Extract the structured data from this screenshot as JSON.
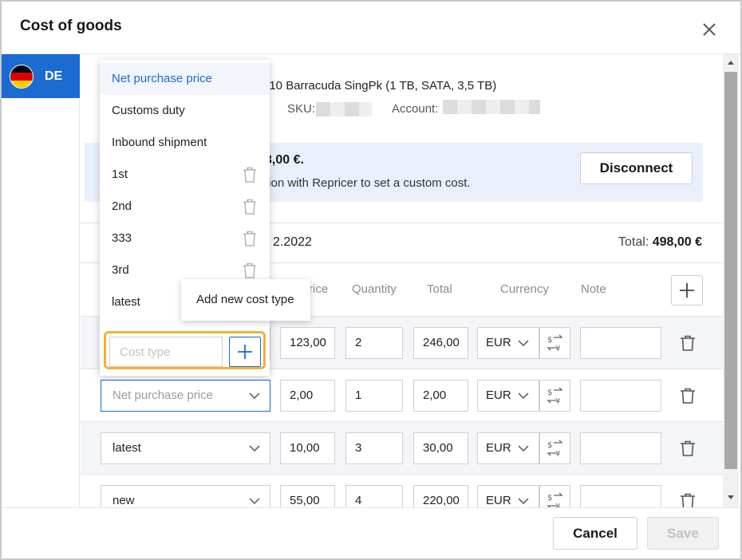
{
  "dialog": {
    "title": "Cost of goods",
    "close_icon": "close-icon"
  },
  "market": {
    "label": "DE",
    "flag_icon": "germany-flag-icon",
    "flag_colors": [
      "#000000",
      "#dd0000",
      "#ffce00"
    ]
  },
  "product": {
    "name": "010 Barracuda SingPk (1 TB, SATA, 3,5 TB)",
    "sku_label": "SKU:",
    "account_label": "Account:"
  },
  "info": {
    "price": "3,00 €.",
    "text": "tion with Repricer to set a custom cost.",
    "disconnect_label": "Disconnect"
  },
  "summary": {
    "date": "2.2022",
    "total_label": "Total:",
    "total_value": "498,00 €"
  },
  "columns": {
    "price": "rice",
    "quantity": "Quantity",
    "total": "Total",
    "currency": "Currency",
    "note": "Note"
  },
  "rows": [
    {
      "cost_type": "",
      "price": "123,00",
      "quantity": "2",
      "total": "246,00",
      "currency": "EUR",
      "note": ""
    },
    {
      "cost_type": "Net purchase price",
      "price": "2,00",
      "quantity": "1",
      "total": "2,00",
      "currency": "EUR",
      "note": ""
    },
    {
      "cost_type": "latest",
      "price": "10,00",
      "quantity": "3",
      "total": "30,00",
      "currency": "EUR",
      "note": ""
    },
    {
      "cost_type": "new",
      "price": "55,00",
      "quantity": "4",
      "total": "220,00",
      "currency": "EUR",
      "note": ""
    }
  ],
  "dropdown": {
    "items": [
      {
        "label": "Net purchase price",
        "deletable": false,
        "selected": true
      },
      {
        "label": "Customs duty",
        "deletable": false,
        "selected": false
      },
      {
        "label": "Inbound shipment",
        "deletable": false,
        "selected": false
      },
      {
        "label": "1st",
        "deletable": true,
        "selected": false
      },
      {
        "label": "2nd",
        "deletable": true,
        "selected": false
      },
      {
        "label": "333",
        "deletable": true,
        "selected": false
      },
      {
        "label": "3rd",
        "deletable": true,
        "selected": false
      },
      {
        "label": "latest",
        "deletable": false,
        "selected": false
      }
    ],
    "input_placeholder": "Cost type",
    "input_value": "",
    "add_tooltip": "Add new cost type"
  },
  "footer": {
    "cancel_label": "Cancel",
    "save_label": "Save"
  },
  "colors": {
    "accent": "#1b6bd1",
    "info_bg": "#e9f0fb",
    "highlight": "#f2b134",
    "row_shade": "#f4f5f8"
  }
}
